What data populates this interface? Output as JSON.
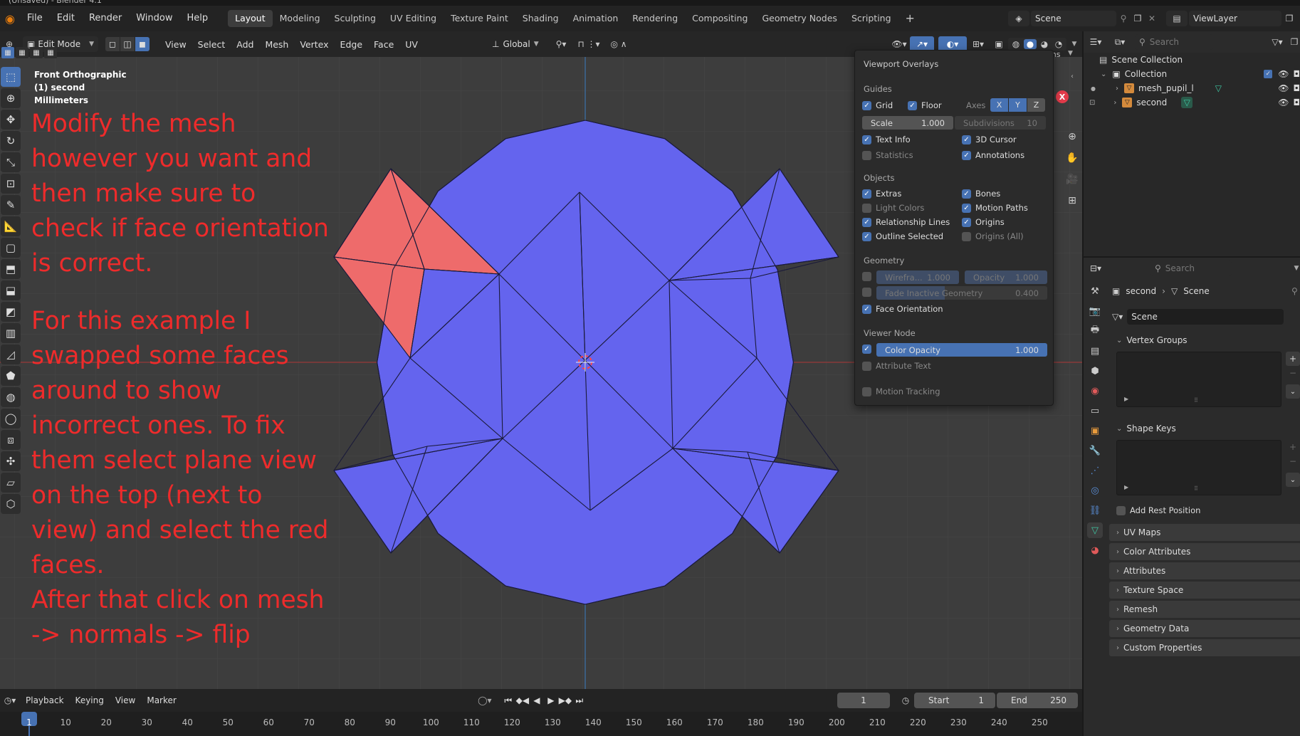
{
  "window_title": "(Unsaved) - Blender 4.1",
  "menu": [
    "File",
    "Edit",
    "Render",
    "Window",
    "Help"
  ],
  "workspaces": [
    "Layout",
    "Modeling",
    "Sculpting",
    "UV Editing",
    "Texture Paint",
    "Shading",
    "Animation",
    "Rendering",
    "Compositing",
    "Geometry Nodes",
    "Scripting"
  ],
  "active_workspace": "Layout",
  "scene_name": "Scene",
  "view_layer": "ViewLayer",
  "header": {
    "mode": "Edit Mode",
    "menus": [
      "View",
      "Select",
      "Add",
      "Mesh",
      "Vertex",
      "Edge",
      "Face",
      "UV"
    ],
    "transform_orientation": "Global"
  },
  "viewport_info": {
    "view_name": "Front Orthographic",
    "object_name": "(1) second",
    "units": "Millimeters"
  },
  "annotation_text": {
    "p1": "Modify the mesh however you want and then make sure to check if face orientation is correct.",
    "p2": "For this example I swapped some faces around to show incorrect ones. To fix them select plane view on the top (next to view) and select the red faces.",
    "p3": "After that click on mesh -> normals -> flip"
  },
  "overlays": {
    "title": "Viewport Overlays",
    "guides_label": "Guides",
    "grid": "Grid",
    "floor": "Floor",
    "axes": "Axes",
    "axis_x": "X",
    "axis_y": "Y",
    "axis_z": "Z",
    "scale_label": "Scale",
    "scale_value": "1.000",
    "subdivisions_label": "Subdivisions",
    "subdivisions_value": "10",
    "text_info": "Text Info",
    "cursor_3d": "3D Cursor",
    "statistics": "Statistics",
    "annotations": "Annotations",
    "objects_label": "Objects",
    "extras": "Extras",
    "bones": "Bones",
    "light_colors": "Light Colors",
    "motion_paths": "Motion Paths",
    "relationship_lines": "Relationship Lines",
    "origins": "Origins",
    "outline_selected": "Outline Selected",
    "origins_all": "Origins (All)",
    "geometry_label": "Geometry",
    "wireframe_label": "Wirefra...",
    "wireframe_value": "1.000",
    "opacity_label": "Opacity",
    "opacity_value": "1.000",
    "fade_label": "Fade Inactive Geometry",
    "fade_value": "0.400",
    "face_orientation": "Face Orientation",
    "viewer_node_label": "Viewer Node",
    "color_opacity_label": "Color Opacity",
    "color_opacity_value": "1.000",
    "attribute_text": "Attribute Text",
    "motion_tracking": "Motion Tracking",
    "ons_fragment": "ons"
  },
  "outliner": {
    "search_placeholder": "Search",
    "scene_collection": "Scene Collection",
    "collection": "Collection",
    "objects": [
      "mesh_pupil_l",
      "second"
    ]
  },
  "properties": {
    "search_placeholder": "Search",
    "breadcrumb_object": "second",
    "breadcrumb_scene": "Scene",
    "datablock": "Scene",
    "panels": [
      "Vertex Groups",
      "Shape Keys",
      "UV Maps",
      "Color Attributes",
      "Attributes",
      "Texture Space",
      "Remesh",
      "Geometry Data",
      "Custom Properties"
    ],
    "add_rest_position": "Add Rest Position"
  },
  "timeline": {
    "menus": [
      "Playback",
      "Keying",
      "View",
      "Marker"
    ],
    "current_frame": "1",
    "start_label": "Start",
    "start_value": "1",
    "end_label": "End",
    "end_value": "250",
    "ticks": [
      "1",
      "10",
      "20",
      "30",
      "40",
      "50",
      "60",
      "70",
      "80",
      "90",
      "100",
      "110",
      "120",
      "130",
      "140",
      "150",
      "160",
      "170",
      "180",
      "190",
      "200",
      "210",
      "220",
      "230",
      "240",
      "250"
    ]
  },
  "colors": {
    "face_front": "#6464ee",
    "face_back": "#ee6b6b",
    "annotation": "#ee2b2b",
    "accent": "#4772b3"
  }
}
